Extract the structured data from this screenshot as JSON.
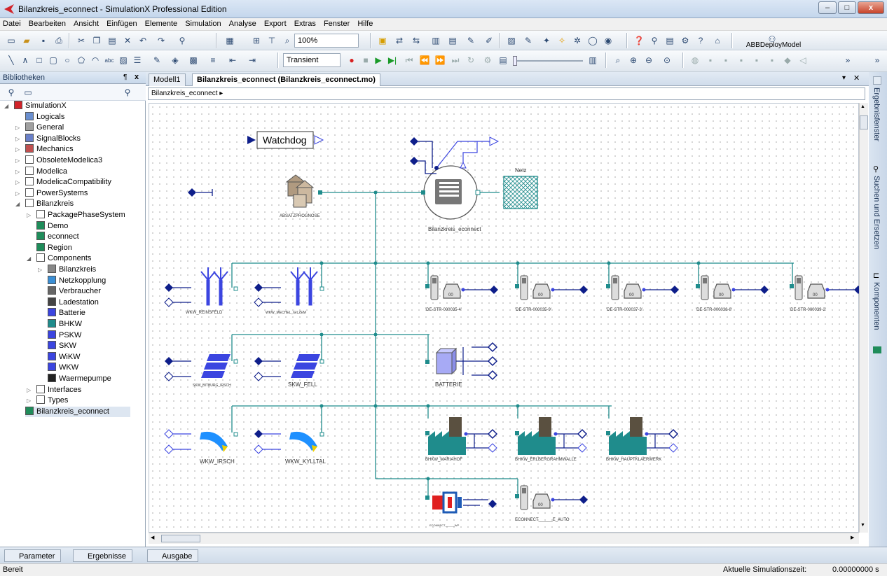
{
  "window": {
    "title": "Bilanzkreis_econnect - SimulationX Professional Edition",
    "minimize": "–",
    "maximize": "□",
    "close": "x"
  },
  "menu": [
    "Datei",
    "Bearbeiten",
    "Ansicht",
    "Einfügen",
    "Elemente",
    "Simulation",
    "Analyse",
    "Export",
    "Extras",
    "Fenster",
    "Hilfe"
  ],
  "toolbar": {
    "zoom": "100%",
    "mode": "Transient",
    "deploy_label": "ABBDeployModel"
  },
  "library": {
    "header": "Bibliotheken",
    "pin": "¶",
    "close": "x",
    "items": [
      {
        "label": "SimulationX",
        "indent": 0,
        "icon": "simulationx-icon",
        "exp": "◢"
      },
      {
        "label": "Logicals",
        "indent": 1,
        "icon": "star-icon",
        "exp": ""
      },
      {
        "label": "General",
        "indent": 1,
        "icon": "folder-icon",
        "exp": "▷"
      },
      {
        "label": "SignalBlocks",
        "indent": 1,
        "icon": "signal-icon",
        "exp": "▷"
      },
      {
        "label": "Mechanics",
        "indent": 1,
        "icon": "mechanics-icon",
        "exp": "▷"
      },
      {
        "label": "ObsoleteModelica3",
        "indent": 1,
        "icon": "package-icon",
        "exp": "▷"
      },
      {
        "label": "Modelica",
        "indent": 1,
        "icon": "package-icon",
        "exp": "▷"
      },
      {
        "label": "ModelicaCompatibility",
        "indent": 1,
        "icon": "package-icon",
        "exp": "▷"
      },
      {
        "label": "PowerSystems",
        "indent": 1,
        "icon": "package-icon",
        "exp": "▷"
      },
      {
        "label": "Bilanzkreis",
        "indent": 1,
        "icon": "package-icon",
        "exp": "◢"
      },
      {
        "label": "PackagePhaseSystem",
        "indent": 2,
        "icon": "package-icon",
        "exp": "▷"
      },
      {
        "label": "Demo",
        "indent": 2,
        "icon": "model-icon",
        "exp": ""
      },
      {
        "label": "econnect",
        "indent": 2,
        "icon": "model-icon",
        "exp": ""
      },
      {
        "label": "Region",
        "indent": 2,
        "icon": "model-icon",
        "exp": ""
      },
      {
        "label": "Components",
        "indent": 2,
        "icon": "package-icon",
        "exp": "◢"
      },
      {
        "label": "Bilanzkreis",
        "indent": 3,
        "icon": "chip-icon",
        "exp": "▷"
      },
      {
        "label": "Netzkopplung",
        "indent": 3,
        "icon": "grid-icon",
        "exp": ""
      },
      {
        "label": "Verbraucher",
        "indent": 3,
        "icon": "consumer-icon",
        "exp": ""
      },
      {
        "label": "Ladestation",
        "indent": 3,
        "icon": "charger-icon",
        "exp": ""
      },
      {
        "label": "Batterie",
        "indent": 3,
        "icon": "battery-icon",
        "exp": ""
      },
      {
        "label": "BHKW",
        "indent": 3,
        "icon": "factory-icon",
        "exp": ""
      },
      {
        "label": "PSKW",
        "indent": 3,
        "icon": "pump-icon",
        "exp": ""
      },
      {
        "label": "SKW",
        "indent": 3,
        "icon": "solar-icon",
        "exp": ""
      },
      {
        "label": "WiKW",
        "indent": 3,
        "icon": "wind-icon",
        "exp": ""
      },
      {
        "label": "WKW",
        "indent": 3,
        "icon": "water-icon",
        "exp": ""
      },
      {
        "label": "Waermepumpe",
        "indent": 3,
        "icon": "heatpump-icon",
        "exp": ""
      },
      {
        "label": "Interfaces",
        "indent": 2,
        "icon": "package-icon",
        "exp": "▷"
      },
      {
        "label": "Types",
        "indent": 2,
        "icon": "package-icon",
        "exp": "▷"
      },
      {
        "label": "Bilanzkreis_econnect",
        "indent": 1,
        "icon": "model-icon",
        "exp": ""
      }
    ]
  },
  "tabs": [
    {
      "label": "Modell1"
    },
    {
      "label": "Bilanzkreis_econnect (Bilanzkreis_econnect.mo)"
    }
  ],
  "breadcrumb": "Bilanzkreis_econnect  ▸",
  "diagram": {
    "watchdog": "Watchdog",
    "netz": "Netz",
    "absatz": "ABSATZPROGNOSE",
    "center": "Bilanzkreis_econnect",
    "wind1": "WKW_REINSFELD",
    "wind2": "WKW_MECHEL_GILZEM",
    "cars": [
      "'DE-STR-000035-4'",
      "'DE-STR-000035-9'",
      "'DE-STR-000037-3'",
      "'DE-STR-000038-8'",
      "'DE-STR-000039-2'"
    ],
    "car_val": "00",
    "solar1": "SKW_BITBURG_IRSCH",
    "solar2": "SKW_FELL",
    "battery": "BATTERIE",
    "hydro1": "WKW_IRSCH",
    "hydro2": "WKW_KYLLTAL",
    "chp": [
      "BHKW_MARIAHOF",
      "BHKW_ERLBERGRAHMWALLE",
      "BHKW_HAUPTKLAERWERK"
    ],
    "econ_wp": "ECONNECT______WP",
    "econ_auto": "ECONNECT______E_AUTO"
  },
  "right_panels": [
    "Ergebnisfenster",
    "Suchen und Ersetzen",
    "Komponenten"
  ],
  "bottom_tabs": [
    "Parameter",
    "Ergebnisse",
    "Ausgabe"
  ],
  "status": {
    "left": "Bereit",
    "time_label": "Aktuelle Simulationszeit:",
    "time_value": "0.00000000 s"
  },
  "colors": {
    "wire": "#1f8c8c",
    "wind": "#3b45e0",
    "solar": "#3b45e0",
    "car": "#555555",
    "port": "#0e1e8a"
  }
}
